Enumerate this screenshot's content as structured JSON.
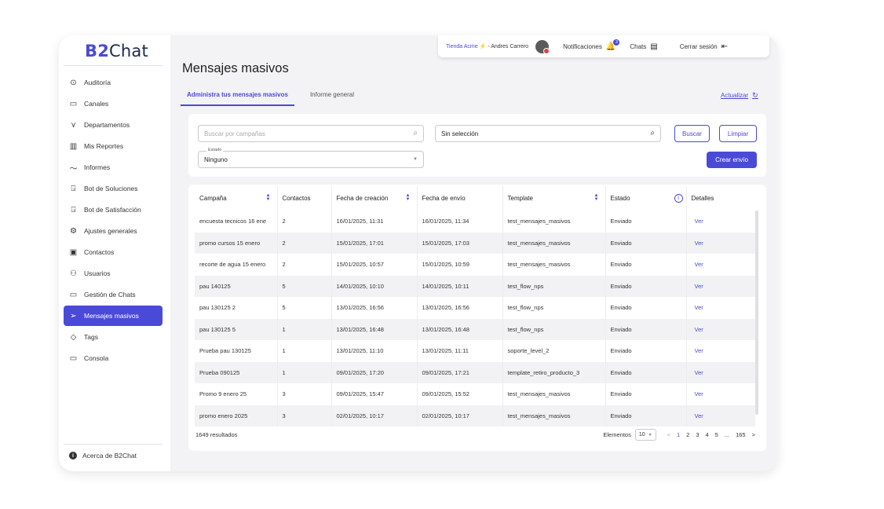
{
  "brand": {
    "logo_bold": "B2",
    "logo_rest": "Chat"
  },
  "sidebar": {
    "items": [
      {
        "label": "Auditoría",
        "icon": "check-circle-icon"
      },
      {
        "label": "Canales",
        "icon": "channels-icon"
      },
      {
        "label": "Departamentos",
        "icon": "departments-icon"
      },
      {
        "label": "Mis Reportes",
        "icon": "reports-icon"
      },
      {
        "label": "Informes",
        "icon": "trend-icon"
      },
      {
        "label": "Bot de Soluciones",
        "icon": "bot-icon"
      },
      {
        "label": "Bot de Satisfacción",
        "icon": "bot-icon"
      },
      {
        "label": "Ajustes generales",
        "icon": "gear-icon"
      },
      {
        "label": "Contactos",
        "icon": "contacts-icon"
      },
      {
        "label": "Usuarios",
        "icon": "users-icon"
      },
      {
        "label": "Gestión de Chats",
        "icon": "chats-icon"
      },
      {
        "label": "Mensajes masivos",
        "icon": "send-icon",
        "active": true
      },
      {
        "label": "Tags",
        "icon": "tag-icon"
      },
      {
        "label": "Consola",
        "icon": "console-icon"
      }
    ],
    "about": "Acerca de B2Chat"
  },
  "header": {
    "store": "Tienda Acme",
    "separator": "⚡",
    "user_name": "- Andres Carrero",
    "notifications_label": "Notificaciones",
    "notifications_count": "3",
    "chats_label": "Chats",
    "logout_label": "Cerrar sesión"
  },
  "page": {
    "title": "Mensajes masivos",
    "tabs": [
      "Administra tus mensajes masivos",
      "Informe general"
    ],
    "refresh_label": "Actualizar"
  },
  "filters": {
    "search_placeholder": "Buscar por campañas",
    "select_value": "Sin selección",
    "search_button": "Buscar",
    "clear_button": "Limpiar",
    "status_legend": "Estado",
    "status_value": "Ninguno",
    "create_button": "Crear envío"
  },
  "table": {
    "headers": [
      "Campaña",
      "Contactos",
      "Fecha de creación",
      "Fecha de envío",
      "Template",
      "Estado",
      "Detalles"
    ],
    "rows": [
      [
        "encuesta tecnicos 16 ene",
        "2",
        "16/01/2025, 11:31",
        "16/01/2025, 11:34",
        "test_mensajes_masivos",
        "Enviado",
        "Ver"
      ],
      [
        "promo cursos 15 enero",
        "2",
        "15/01/2025, 17:01",
        "15/01/2025, 17:03",
        "test_mensajes_masivos",
        "Enviado",
        "Ver"
      ],
      [
        "recorte de agua 15 enero",
        "2",
        "15/01/2025, 10:57",
        "15/01/2025, 10:59",
        "test_mensajes_masivos",
        "Enviado",
        "Ver"
      ],
      [
        "pau 140125",
        "5",
        "14/01/2025, 10:10",
        "14/01/2025, 10:11",
        "test_flow_nps",
        "Enviado",
        "Ver"
      ],
      [
        "pau 130125 2",
        "5",
        "13/01/2025, 16:56",
        "13/01/2025, 16:56",
        "test_flow_nps",
        "Enviado",
        "Ver"
      ],
      [
        "pau 130125 5",
        "1",
        "13/01/2025, 16:48",
        "13/01/2025, 16:48",
        "test_flow_nps",
        "Enviado",
        "Ver"
      ],
      [
        "Prueba pau 130125",
        "1",
        "13/01/2025, 11:10",
        "13/01/2025, 11:11",
        "soporte_level_2",
        "Enviado",
        "Ver"
      ],
      [
        "Prueba 090125",
        "1",
        "09/01/2025, 17:20",
        "09/01/2025, 17:21",
        "template_retiro_producto_3",
        "Enviado",
        "Ver"
      ],
      [
        "Promo 9 enero 25",
        "3",
        "09/01/2025, 15:47",
        "09/01/2025, 15:52",
        "test_mensajes_masivos",
        "Enviado",
        "Ver"
      ],
      [
        "promo enero 2025",
        "3",
        "02/01/2025, 10:17",
        "02/01/2025, 10:17",
        "test_mensajes_masivos",
        "Enviado",
        "Ver"
      ]
    ],
    "results": "1649 resultados",
    "elements_label": "Elementos",
    "page_size": "10",
    "pages": [
      "<",
      "1",
      "2",
      "3",
      "4",
      "5",
      "...",
      "165",
      ">"
    ]
  },
  "colors": {
    "accent": "#4a4ad8",
    "background": "#f3f3f5"
  }
}
